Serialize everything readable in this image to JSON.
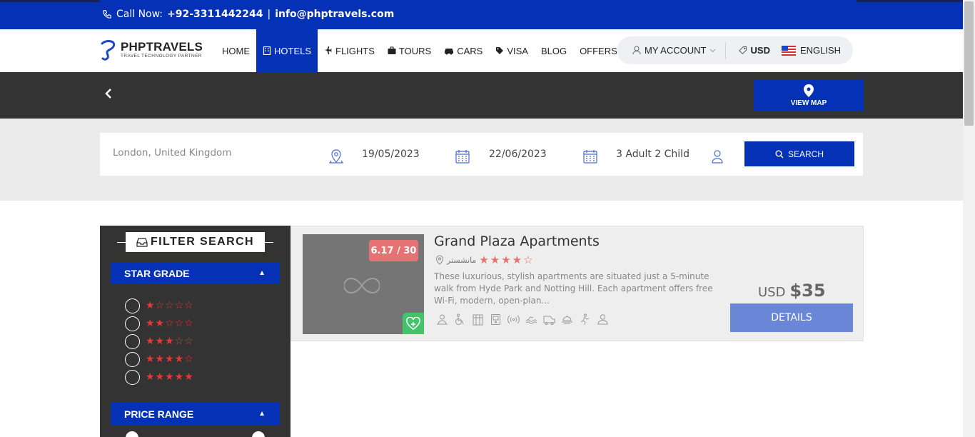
{
  "topbar": {
    "call_label": "Call Now:",
    "phone": "+92-3311442244",
    "separator": "|",
    "email": "info@phptravels.com"
  },
  "header": {
    "logo_name": "PHPTRAVELS",
    "logo_tagline": "TRAVEL TECHNOLOGY PARTNER",
    "nav": [
      {
        "label": "HOME",
        "icon": null,
        "active": false
      },
      {
        "label": "HOTELS",
        "icon": "building-icon",
        "active": true
      },
      {
        "label": "FLIGHTS",
        "icon": "plane-icon",
        "active": false
      },
      {
        "label": "TOURS",
        "icon": "suitcase-icon",
        "active": false
      },
      {
        "label": "CARS",
        "icon": "car-icon",
        "active": false
      },
      {
        "label": "VISA",
        "icon": "tag-icon",
        "active": false
      },
      {
        "label": "BLOG",
        "icon": null,
        "active": false
      },
      {
        "label": "OFFERS",
        "icon": null,
        "active": false
      }
    ],
    "account_label": "MY ACCOUNT",
    "currency": "USD",
    "language": "ENGLISH"
  },
  "darkbar": {
    "view_map_label": "VIEW MAP"
  },
  "search": {
    "location": "London, United Kingdom",
    "checkin": "19/05/2023",
    "checkout": "22/06/2023",
    "guests": "3 Adult 2 Child",
    "button_label": "SEARCH"
  },
  "sidebar": {
    "title": "FILTER SEARCH",
    "star_grade_label": "STAR GRADE",
    "star_options": [
      1,
      2,
      3,
      4,
      5
    ],
    "price_range_label": "PRICE RANGE"
  },
  "hotel": {
    "name": "Grand Plaza Apartments",
    "rating_badge": "6.17 / 30",
    "location": "مانشستر",
    "stars": 4,
    "description": "These luxurious, stylish apartments are situated just a 5-minute walk from Hyde Park and Notting Hill. Each apartment offers free Wi-Fi, modern, open-plan...",
    "price_currency": "USD",
    "price_amount": "$35",
    "details_label": "DETAILS",
    "amenities": [
      "reception-icon",
      "wheelchair-icon",
      "building-icon",
      "safe-icon",
      "wifi-icon",
      "pool-icon",
      "shuttle-icon",
      "restaurant-icon",
      "fitness-icon",
      "user-icon"
    ]
  },
  "colors": {
    "brand_blue": "#0431b5",
    "dark_bar": "#333333",
    "star_red": "#e53935",
    "rating_badge": "#e57373",
    "fav_green": "#43c46b",
    "details_button": "#6a86d6"
  }
}
